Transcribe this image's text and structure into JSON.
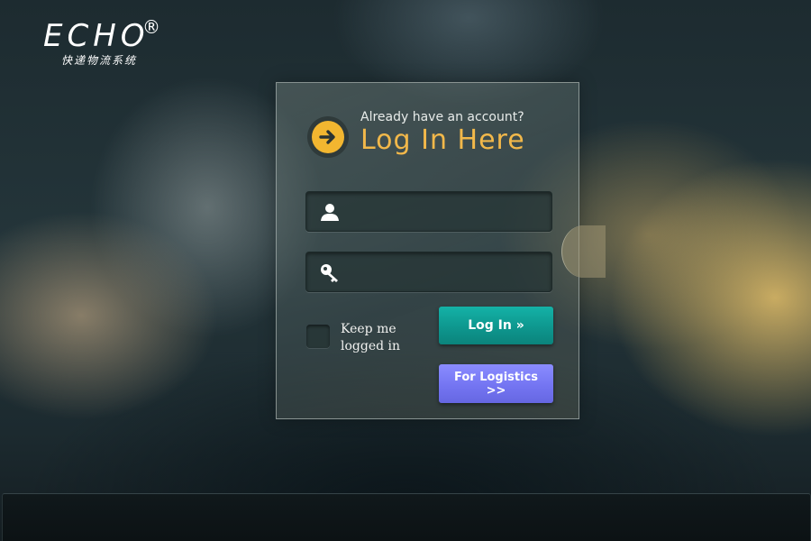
{
  "logo": {
    "word": "ECHO",
    "registered": "®",
    "subtitle": "快递物流系统"
  },
  "login": {
    "prompt": "Already have an account?",
    "heading": "Log In Here",
    "username_value": "",
    "password_value": "",
    "keep_logged_in_label": "Keep me logged in",
    "keep_logged_in_checked": false,
    "login_button": "Log In »",
    "logistics_button": "For Logistics  >>"
  },
  "icons": {
    "badge": "arrow-right-circle-icon",
    "username": "user-icon",
    "password": "key-icon"
  },
  "colors": {
    "accent_heading": "#f2b84a",
    "login_button": "#0e978e",
    "logistics_button": "#7475f2"
  }
}
